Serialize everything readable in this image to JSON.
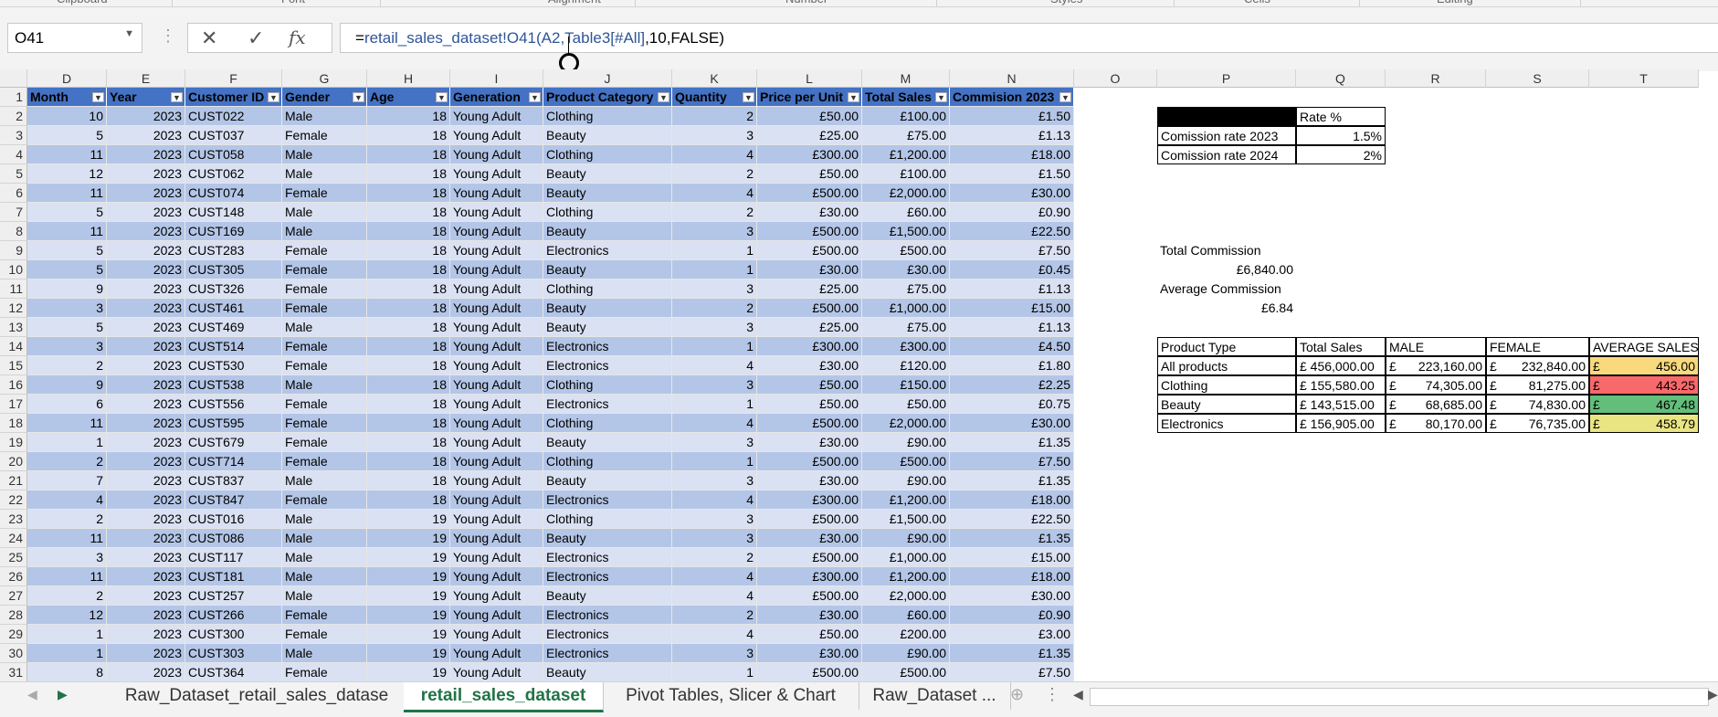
{
  "ribbon": {
    "groups": [
      "Clipboard",
      "Font",
      "Alignment",
      "Number",
      "Styles",
      "Cells",
      "Editing"
    ]
  },
  "formula_bar": {
    "name_box": "O41",
    "cancel_icon": "✕",
    "enter_icon": "✓",
    "fx_label": "fx",
    "formula_eq": "=",
    "formula_ref": "retail_sales_dataset!O41(A2,Table3[#All]",
    "formula_rest": ",10,FALSE)"
  },
  "columns": [
    "D",
    "E",
    "F",
    "G",
    "H",
    "I",
    "J",
    "K",
    "L",
    "M",
    "N",
    "O",
    "P",
    "Q",
    "R",
    "S",
    "T"
  ],
  "table": {
    "headers": [
      "Month",
      "Year",
      "Customer ID",
      "Gender",
      "Age",
      "Generation",
      "Product Category",
      "Quantity",
      "Price per Unit",
      "Total Sales",
      "Commision 2023"
    ],
    "rows": [
      [
        "10",
        "2023",
        "CUST022",
        "Male",
        "18",
        "Young Adult",
        "Clothing",
        "2",
        "£50.00",
        "£100.00",
        "£1.50"
      ],
      [
        "5",
        "2023",
        "CUST037",
        "Female",
        "18",
        "Young Adult",
        "Beauty",
        "3",
        "£25.00",
        "£75.00",
        "£1.13"
      ],
      [
        "11",
        "2023",
        "CUST058",
        "Male",
        "18",
        "Young Adult",
        "Clothing",
        "4",
        "£300.00",
        "£1,200.00",
        "£18.00"
      ],
      [
        "12",
        "2023",
        "CUST062",
        "Male",
        "18",
        "Young Adult",
        "Beauty",
        "2",
        "£50.00",
        "£100.00",
        "£1.50"
      ],
      [
        "11",
        "2023",
        "CUST074",
        "Female",
        "18",
        "Young Adult",
        "Beauty",
        "4",
        "£500.00",
        "£2,000.00",
        "£30.00"
      ],
      [
        "5",
        "2023",
        "CUST148",
        "Male",
        "18",
        "Young Adult",
        "Clothing",
        "2",
        "£30.00",
        "£60.00",
        "£0.90"
      ],
      [
        "11",
        "2023",
        "CUST169",
        "Male",
        "18",
        "Young Adult",
        "Beauty",
        "3",
        "£500.00",
        "£1,500.00",
        "£22.50"
      ],
      [
        "5",
        "2023",
        "CUST283",
        "Female",
        "18",
        "Young Adult",
        "Electronics",
        "1",
        "£500.00",
        "£500.00",
        "£7.50"
      ],
      [
        "5",
        "2023",
        "CUST305",
        "Female",
        "18",
        "Young Adult",
        "Beauty",
        "1",
        "£30.00",
        "£30.00",
        "£0.45"
      ],
      [
        "9",
        "2023",
        "CUST326",
        "Female",
        "18",
        "Young Adult",
        "Clothing",
        "3",
        "£25.00",
        "£75.00",
        "£1.13"
      ],
      [
        "3",
        "2023",
        "CUST461",
        "Female",
        "18",
        "Young Adult",
        "Beauty",
        "2",
        "£500.00",
        "£1,000.00",
        "£15.00"
      ],
      [
        "5",
        "2023",
        "CUST469",
        "Male",
        "18",
        "Young Adult",
        "Beauty",
        "3",
        "£25.00",
        "£75.00",
        "£1.13"
      ],
      [
        "3",
        "2023",
        "CUST514",
        "Female",
        "18",
        "Young Adult",
        "Electronics",
        "1",
        "£300.00",
        "£300.00",
        "£4.50"
      ],
      [
        "2",
        "2023",
        "CUST530",
        "Female",
        "18",
        "Young Adult",
        "Electronics",
        "4",
        "£30.00",
        "£120.00",
        "£1.80"
      ],
      [
        "9",
        "2023",
        "CUST538",
        "Male",
        "18",
        "Young Adult",
        "Clothing",
        "3",
        "£50.00",
        "£150.00",
        "£2.25"
      ],
      [
        "6",
        "2023",
        "CUST556",
        "Female",
        "18",
        "Young Adult",
        "Electronics",
        "1",
        "£50.00",
        "£50.00",
        "£0.75"
      ],
      [
        "11",
        "2023",
        "CUST595",
        "Female",
        "18",
        "Young Adult",
        "Clothing",
        "4",
        "£500.00",
        "£2,000.00",
        "£30.00"
      ],
      [
        "1",
        "2023",
        "CUST679",
        "Female",
        "18",
        "Young Adult",
        "Beauty",
        "3",
        "£30.00",
        "£90.00",
        "£1.35"
      ],
      [
        "2",
        "2023",
        "CUST714",
        "Female",
        "18",
        "Young Adult",
        "Clothing",
        "1",
        "£500.00",
        "£500.00",
        "£7.50"
      ],
      [
        "7",
        "2023",
        "CUST837",
        "Male",
        "18",
        "Young Adult",
        "Beauty",
        "3",
        "£30.00",
        "£90.00",
        "£1.35"
      ],
      [
        "4",
        "2023",
        "CUST847",
        "Female",
        "18",
        "Young Adult",
        "Electronics",
        "4",
        "£300.00",
        "£1,200.00",
        "£18.00"
      ],
      [
        "2",
        "2023",
        "CUST016",
        "Male",
        "19",
        "Young Adult",
        "Clothing",
        "3",
        "£500.00",
        "£1,500.00",
        "£22.50"
      ],
      [
        "11",
        "2023",
        "CUST086",
        "Male",
        "19",
        "Young Adult",
        "Beauty",
        "3",
        "£30.00",
        "£90.00",
        "£1.35"
      ],
      [
        "3",
        "2023",
        "CUST117",
        "Male",
        "19",
        "Young Adult",
        "Electronics",
        "2",
        "£500.00",
        "£1,000.00",
        "£15.00"
      ],
      [
        "11",
        "2023",
        "CUST181",
        "Male",
        "19",
        "Young Adult",
        "Electronics",
        "4",
        "£300.00",
        "£1,200.00",
        "£18.00"
      ],
      [
        "2",
        "2023",
        "CUST257",
        "Male",
        "19",
        "Young Adult",
        "Beauty",
        "4",
        "£500.00",
        "£2,000.00",
        "£30.00"
      ],
      [
        "12",
        "2023",
        "CUST266",
        "Female",
        "19",
        "Young Adult",
        "Electronics",
        "2",
        "£30.00",
        "£60.00",
        "£0.90"
      ],
      [
        "1",
        "2023",
        "CUST300",
        "Female",
        "19",
        "Young Adult",
        "Electronics",
        "4",
        "£50.00",
        "£200.00",
        "£3.00"
      ],
      [
        "1",
        "2023",
        "CUST303",
        "Male",
        "19",
        "Young Adult",
        "Electronics",
        "3",
        "£30.00",
        "£90.00",
        "£1.35"
      ],
      [
        "8",
        "2023",
        "CUST364",
        "Female",
        "19",
        "Young Adult",
        "Beauty",
        "1",
        "£500.00",
        "£500.00",
        "£7.50"
      ]
    ]
  },
  "rate_table": {
    "header_label": "Rate %",
    "rows": [
      {
        "label": "Comission rate 2023",
        "value": "1.5%"
      },
      {
        "label": "Comission rate 2024",
        "value": "2%"
      }
    ]
  },
  "commission": {
    "total_label": "Total Commission",
    "total_value": "£6,840.00",
    "average_label": "Average Commission",
    "average_value": "£6.84"
  },
  "summary": {
    "headers": [
      "Product Type",
      "Total Sales",
      "MALE",
      "FEMALE",
      "AVERAGE SALES"
    ],
    "currency": "£",
    "rows": [
      {
        "type": "All products",
        "total": "£ 456,000.00",
        "male": "223,160.00",
        "female": "232,840.00",
        "avg": "456.00",
        "color": "#f9d97e"
      },
      {
        "type": "Clothing",
        "total": "£ 155,580.00",
        "male": "74,305.00",
        "female": "81,275.00",
        "avg": "443.25",
        "color": "#f8696b"
      },
      {
        "type": "Beauty",
        "total": "£ 143,515.00",
        "male": "68,685.00",
        "female": "74,830.00",
        "avg": "467.48",
        "color": "#63be7b"
      },
      {
        "type": "Electronics",
        "total": "£ 156,905.00",
        "male": "80,170.00",
        "female": "76,735.00",
        "avg": "458.79",
        "color": "#e9e583"
      }
    ]
  },
  "sheet_tabs": [
    "Raw_Dataset_retail_sales_datase",
    "retail_sales_dataset",
    "Pivot Tables, Slicer & Chart",
    "Raw_Dataset ..."
  ],
  "active_tab": 1
}
